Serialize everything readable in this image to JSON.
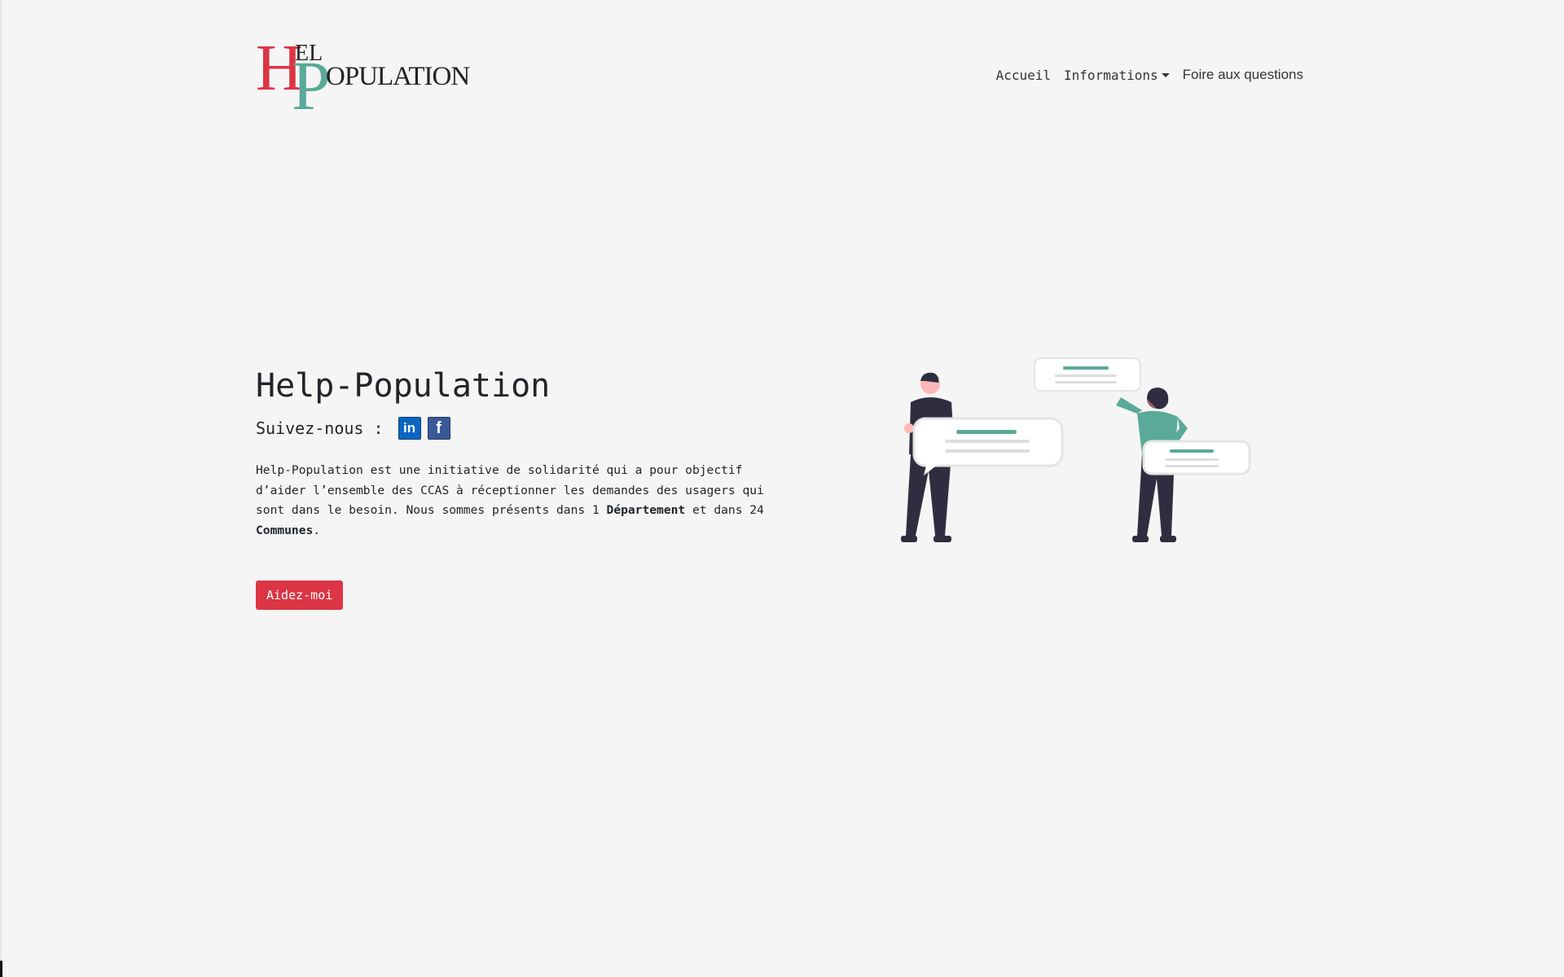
{
  "logo": {
    "h": "H",
    "el": "EL",
    "p": "P",
    "opulation": "OPULATION"
  },
  "nav": {
    "accueil": "Accueil",
    "informations": "Informations",
    "faq": "Foire aux questions"
  },
  "hero": {
    "title": "Help-Population",
    "follow_label": "Suivez-nous :",
    "linkedin_glyph": "in",
    "facebook_glyph": "f",
    "desc_part1": "Help-Population est une initiative de solidarité qui a pour objectif d’aider l’ensemble des CCAS à réceptionner les demandes des usagers qui sont dans le besoin. Nous sommes présents dans 1 ",
    "desc_bold1": "Département",
    "desc_part2": " et dans 24 ",
    "desc_bold2": "Communes",
    "desc_part3": ".",
    "button_label": "Aidez-moi"
  },
  "colors": {
    "accent_red": "#dc3545",
    "accent_teal": "#5aa99a",
    "dark_figure": "#2f2e41"
  }
}
